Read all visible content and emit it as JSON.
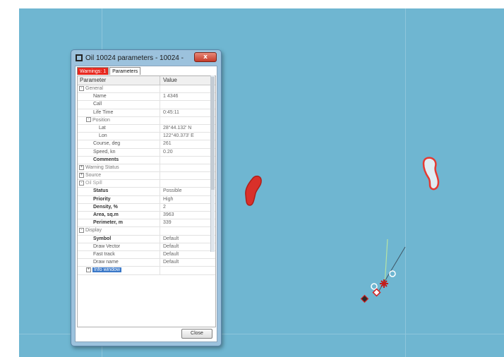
{
  "window": {
    "title": "Oil 10024 parameters - 10024 -",
    "close_symbol": "x"
  },
  "tabs": [
    {
      "label": "Warnings: 1"
    },
    {
      "label": "Parameters"
    }
  ],
  "grid": {
    "header": {
      "parameter": "Parameter",
      "value": "Value"
    },
    "rows": [
      {
        "key": "General",
        "value": ""
      },
      {
        "key": "Name",
        "value": "1 4346"
      },
      {
        "key": "Call",
        "value": ""
      },
      {
        "key": "Life Time",
        "value": "0:45:11"
      },
      {
        "key": "Position",
        "value": ""
      },
      {
        "key": "Lat",
        "value": "28°44.132' N"
      },
      {
        "key": "Lon",
        "value": "122°40.373' E"
      },
      {
        "key": "Course, deg",
        "value": "261"
      },
      {
        "key": "Speed, kn",
        "value": "0.20"
      },
      {
        "key": "Comments",
        "value": ""
      },
      {
        "key": "Warning Status",
        "value": ""
      },
      {
        "key": "Source",
        "value": ""
      },
      {
        "key": "Oil Spill",
        "value": ""
      },
      {
        "key": "Status",
        "value": "Possible"
      },
      {
        "key": "Priority",
        "value": "High"
      },
      {
        "key": "Density, %",
        "value": "2"
      },
      {
        "key": "Area, sq.m",
        "value": "3963"
      },
      {
        "key": "Perimeter, m",
        "value": "339"
      },
      {
        "key": "Display",
        "value": ""
      },
      {
        "key": "Symbol",
        "value": "Default"
      },
      {
        "key": "Draw Vector",
        "value": "Default"
      },
      {
        "key": "Fast track",
        "value": "Default"
      },
      {
        "key": "Draw name",
        "value": "Default"
      },
      {
        "key": "Info window",
        "value": ""
      }
    ]
  },
  "buttons": {
    "close": "Close"
  },
  "colors": {
    "sea": "#6fb6d1",
    "spill_outline": "#e53a32",
    "spill_fill_solid": "#d9302a",
    "tab_warning": "#e8281f",
    "selection": "#3a78c8"
  },
  "icons": [
    "dialog-window-icon",
    "expand-toggle-icon",
    "target-marker-icon",
    "vessel-icon"
  ]
}
